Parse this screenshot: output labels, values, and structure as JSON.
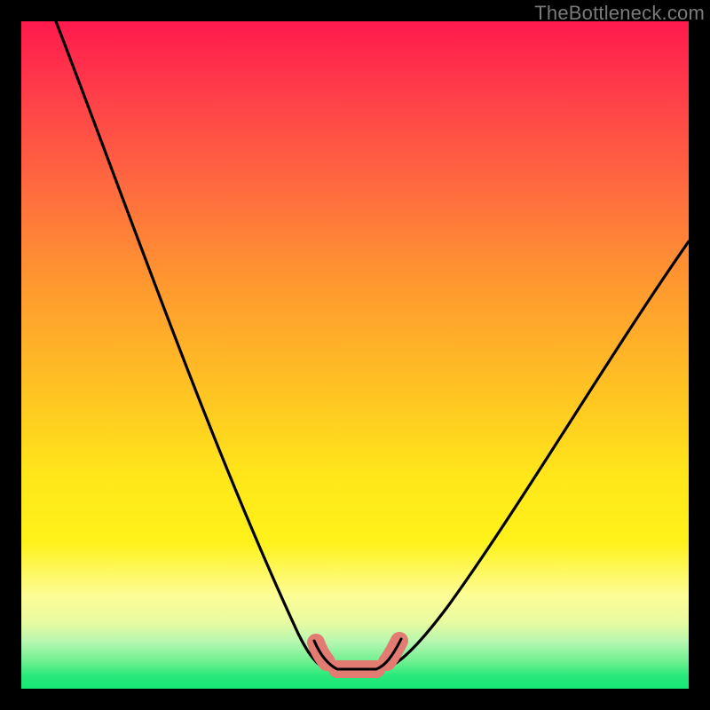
{
  "watermark": "TheBottleneck.com",
  "colors": {
    "frame": "#000000",
    "watermark": "#7a7a7a",
    "curve": "#000000",
    "highlight_fill": "#e27b72",
    "highlight_stroke": "#e27b72",
    "gradient_top": "#ff1a4d",
    "gradient_bottom": "#16e777"
  },
  "chart_data": {
    "type": "line",
    "title": "",
    "xlabel": "",
    "ylabel": "",
    "xlim": [
      0,
      100
    ],
    "ylim": [
      0,
      100
    ],
    "grid": false,
    "legend_position": "none",
    "description": "Bottleneck severity curve: background hue encodes severity (red=100, green=0). Black V-shaped curve shows bottleneck percentage vs component balance. Pink capsule marks the optimal low-bottleneck region near the trough.",
    "series": [
      {
        "name": "bottleneck_curve",
        "x": [
          5,
          10,
          15,
          20,
          25,
          30,
          35,
          40,
          43,
          46,
          48,
          50,
          52,
          55,
          60,
          65,
          70,
          75,
          80,
          85,
          90,
          95,
          100
        ],
        "y": [
          100,
          90,
          80,
          69,
          58,
          47,
          36,
          24,
          15,
          8,
          4,
          3,
          3,
          4,
          8,
          15,
          23,
          31,
          39,
          46,
          53,
          60,
          67
        ]
      }
    ],
    "annotations": [
      {
        "name": "optimal_range_marker",
        "x_start": 44,
        "x_end": 56,
        "y": 3
      }
    ]
  }
}
